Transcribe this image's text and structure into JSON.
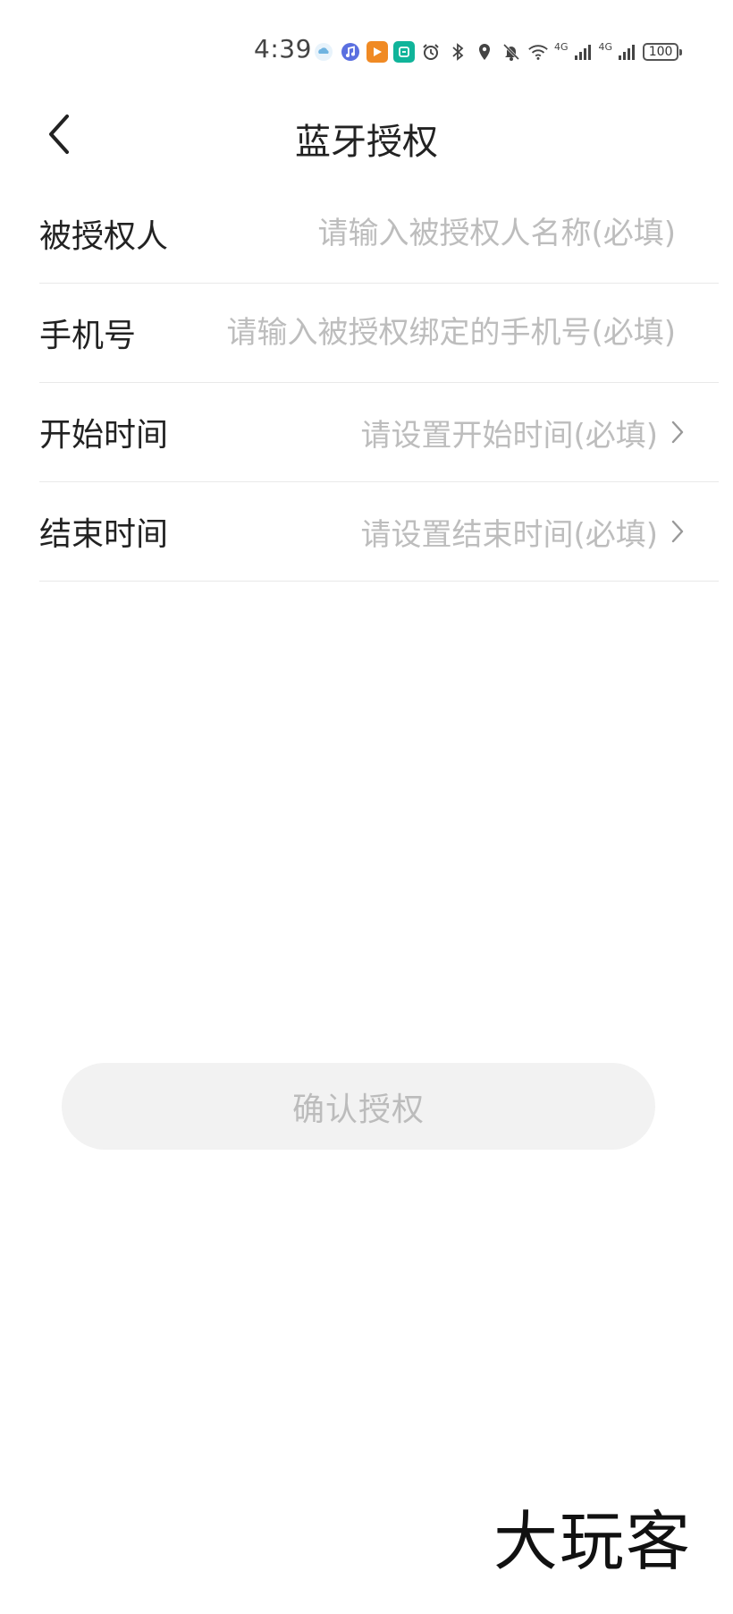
{
  "status_bar": {
    "time": "4:39",
    "icons": [
      "cloud-app-icon",
      "music-app-icon",
      "video-app-icon",
      "home-app-icon",
      "alarm-icon",
      "bluetooth-icon",
      "location-icon",
      "mute-icon",
      "wifi-icon",
      "signal-icon",
      "signal-icon"
    ],
    "network_1": "4G",
    "network_2": "4G",
    "battery": "100"
  },
  "header": {
    "title": "蓝牙授权",
    "back_icon": "chevron-left-icon"
  },
  "form": {
    "grantee": {
      "label": "被授权人",
      "placeholder": "请输入被授权人名称(必填)",
      "value": ""
    },
    "phone": {
      "label": "手机号",
      "placeholder": "请输入被授权绑定的手机号(必填)",
      "value": ""
    },
    "start_time": {
      "label": "开始时间",
      "placeholder": "请设置开始时间(必填)"
    },
    "end_time": {
      "label": "结束时间",
      "placeholder": "请设置结束时间(必填)"
    }
  },
  "confirm_button": {
    "label": "确认授权"
  },
  "watermark": {
    "text": "大玩客"
  },
  "colors": {
    "placeholder": "#bdbdbd",
    "divider": "#e9e9e9",
    "button_bg": "#f2f2f2",
    "button_text": "#bcbcbc"
  }
}
